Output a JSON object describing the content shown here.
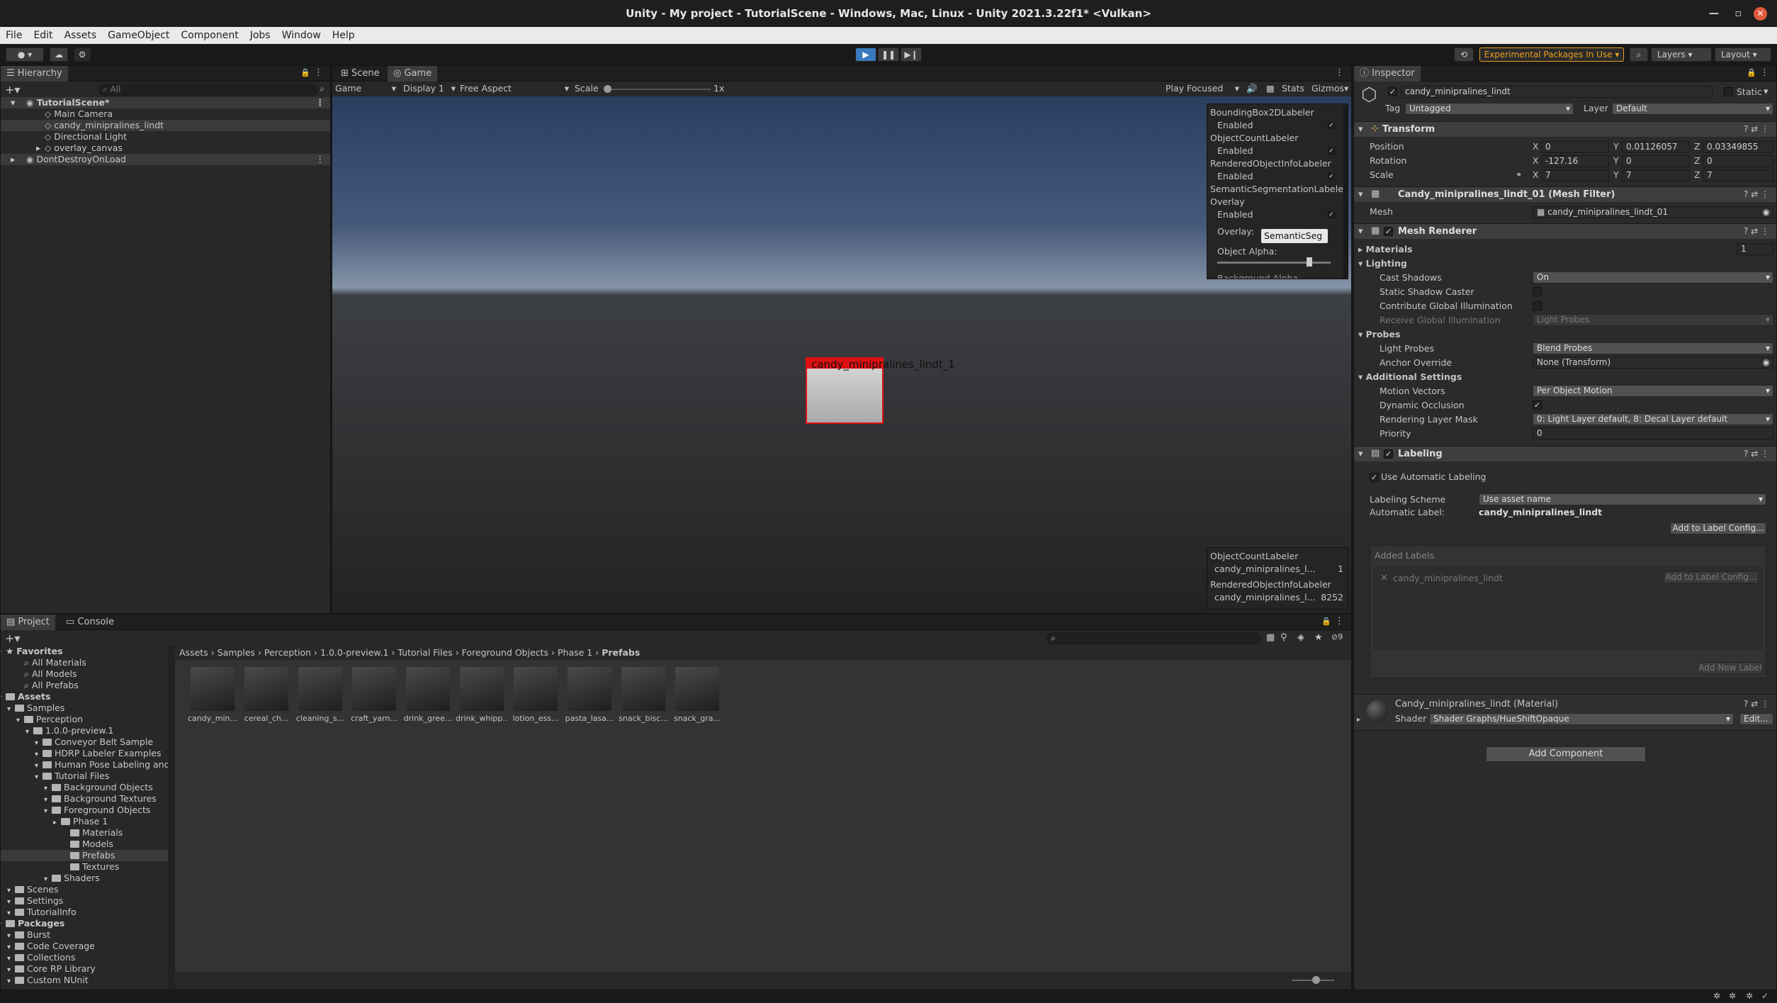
{
  "title": "Unity - My project - TutorialScene - Windows, Mac, Linux - Unity 2021.3.22f1* <Vulkan>",
  "menu": [
    "File",
    "Edit",
    "Assets",
    "GameObject",
    "Component",
    "Jobs",
    "Window",
    "Help"
  ],
  "toolbar": {
    "experimental": "Experimental Packages In Use",
    "layers": "Layers",
    "layout": "Layout"
  },
  "hierarchy": {
    "tab": "Hierarchy",
    "search": "All",
    "scene": "TutorialScene*",
    "items": [
      "Main Camera",
      "candy_minipralines_lindt",
      "Directional Light",
      "overlay_canvas"
    ],
    "dont_destroy": "DontDestroyOnLoad"
  },
  "view": {
    "tab_scene": "Scene",
    "tab_game": "Game",
    "game_dropdown": "Game",
    "display": "Display 1",
    "aspect": "Free Aspect",
    "scale_label": "Scale",
    "scale_value": "1x",
    "play_focused": "Play Focused",
    "stats": "Stats",
    "gizmos": "Gizmos",
    "bbox_label": "candy_minipralines_lindt_1"
  },
  "overlay_top": {
    "rows": [
      "BoundingBox2DLabeler",
      "Enabled",
      "ObjectCountLabeler",
      "Enabled",
      "RenderedObjectInfoLabeler",
      "Enabled",
      "SemanticSegmentationLabeler",
      "Overlay",
      "Enabled"
    ],
    "overlay_label": "Overlay:",
    "overlay_value": "SemanticSeg",
    "alpha_label": "Object Alpha:",
    "cut_text": "Background Alpha"
  },
  "overlay_bottom": {
    "h1": "ObjectCountLabeler",
    "r1": "candy_minipralines_l...",
    "v1": "1",
    "h2": "RenderedObjectInfoLabeler",
    "r2": "candy_minipralines_l...",
    "v2": "8252"
  },
  "project": {
    "tab_project": "Project",
    "tab_console": "Console",
    "badge": "9",
    "breadcrumb": [
      "Assets",
      "Samples",
      "Perception",
      "1.0.0-preview.1",
      "Tutorial Files",
      "Foreground Objects",
      "Phase 1",
      "Prefabs"
    ],
    "tree": [
      {
        "t": "Favorites",
        "d": 0,
        "b": true
      },
      {
        "t": "All Materials",
        "d": 2,
        "s": true
      },
      {
        "t": "All Models",
        "d": 2,
        "s": true
      },
      {
        "t": "All Prefabs",
        "d": 2,
        "s": true
      },
      {
        "t": "Assets",
        "d": 0,
        "b": true
      },
      {
        "t": "Samples",
        "d": 1
      },
      {
        "t": "Perception",
        "d": 2
      },
      {
        "t": "1.0.0-preview.1",
        "d": 3
      },
      {
        "t": "Conveyor Belt Sample",
        "d": 4
      },
      {
        "t": "HDRP Labeler Examples",
        "d": 4
      },
      {
        "t": "Human Pose Labeling and",
        "d": 4
      },
      {
        "t": "Tutorial Files",
        "d": 4
      },
      {
        "t": "Background Objects",
        "d": 5
      },
      {
        "t": "Background Textures",
        "d": 5
      },
      {
        "t": "Foreground Objects",
        "d": 5
      },
      {
        "t": "Phase 1",
        "d": 6
      },
      {
        "t": "Materials",
        "d": 7
      },
      {
        "t": "Models",
        "d": 7
      },
      {
        "t": "Prefabs",
        "d": 7,
        "sel": true
      },
      {
        "t": "Textures",
        "d": 7
      },
      {
        "t": "Shaders",
        "d": 5
      },
      {
        "t": "Scenes",
        "d": 1
      },
      {
        "t": "Settings",
        "d": 1
      },
      {
        "t": "TutorialInfo",
        "d": 1
      },
      {
        "t": "Packages",
        "d": 0,
        "b": true
      },
      {
        "t": "Burst",
        "d": 1
      },
      {
        "t": "Code Coverage",
        "d": 1
      },
      {
        "t": "Collections",
        "d": 1
      },
      {
        "t": "Core RP Library",
        "d": 1
      },
      {
        "t": "Custom NUnit",
        "d": 1
      }
    ],
    "assets": [
      "candy_min...",
      "cereal_ch...",
      "cleaning_s...",
      "craft_yarn...",
      "drink_gree...",
      "drink_whipp...",
      "lotion_ess...",
      "pasta_lasa...",
      "snack_bisc...",
      "snack_gra..."
    ]
  },
  "inspector": {
    "tab": "Inspector",
    "name": "candy_minipralines_lindt",
    "static": "Static",
    "tag_label": "Tag",
    "tag": "Untagged",
    "layer_label": "Layer",
    "layer": "Default",
    "transform": {
      "title": "Transform",
      "position": "Position",
      "rotation": "Rotation",
      "scale": "Scale",
      "px": "0",
      "py": "0.01126057",
      "pz": "0.03349855",
      "rx": "-127.16",
      "ry": "0",
      "rz": "0",
      "sx": "7",
      "sy": "7",
      "sz": "7",
      "x": "X",
      "y": "Y",
      "z": "Z"
    },
    "meshfilter": {
      "title": "Candy_minipralines_lindt_01 (Mesh Filter)",
      "mesh_label": "Mesh",
      "mesh": "candy_minipralines_lindt_01"
    },
    "renderer": {
      "title": "Mesh Renderer",
      "materials": "Materials",
      "materials_count": "1",
      "lighting": "Lighting",
      "cast_shadows": "Cast Shadows",
      "cast_shadows_v": "On",
      "static_shadow": "Static Shadow Caster",
      "contribute_gi": "Contribute Global Illumination",
      "receive_gi": "Receive Global Illumination",
      "receive_gi_v": "Light Probes",
      "probes": "Probes",
      "light_probes": "Light Probes",
      "light_probes_v": "Blend Probes",
      "anchor": "Anchor Override",
      "anchor_v": "None (Transform)",
      "additional": "Additional Settings",
      "motion": "Motion Vectors",
      "motion_v": "Per Object Motion",
      "dyn_occ": "Dynamic Occlusion",
      "rlm": "Rendering Layer Mask",
      "rlm_v": "0: Light Layer default, 8: Decal Layer default",
      "priority": "Priority",
      "priority_v": "0"
    },
    "labeling": {
      "title": "Labeling",
      "auto": "Use Automatic Labeling",
      "scheme_label": "Labeling Scheme",
      "scheme": "Use asset name",
      "auto_label": "Automatic Label:",
      "auto_value": "candy_minipralines_lindt",
      "add_config": "Add to Label Config...",
      "added": "Added Labels",
      "label_item": "candy_minipralines_lindt",
      "add_config2": "Add to Label Config...",
      "add_new": "Add New Label"
    },
    "material": {
      "title": "Candy_minipralines_lindt (Material)",
      "shader_label": "Shader",
      "shader": "Shader Graphs/HueShiftOpaque",
      "edit": "Edit..."
    },
    "add_component": "Add Component"
  },
  "colors": {
    "accent": "#3a79bb",
    "bbox": "#e01010",
    "experimental": "#e8a020"
  }
}
